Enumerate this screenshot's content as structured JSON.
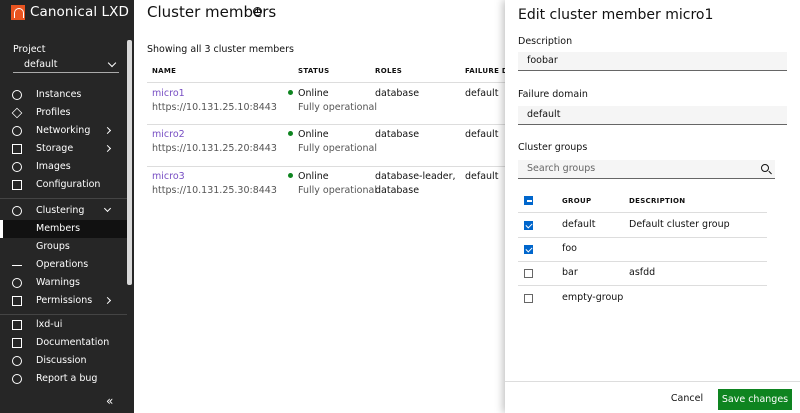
{
  "app": {
    "brand": "Canonical LXD"
  },
  "sidebar": {
    "project_label": "Project",
    "project_value": "default",
    "items": [
      {
        "label": "Instances",
        "icon": "instances-icon"
      },
      {
        "label": "Profiles",
        "icon": "profiles-icon"
      },
      {
        "label": "Networking",
        "icon": "networking-icon"
      },
      {
        "label": "Storage",
        "icon": "storage-icon"
      },
      {
        "label": "Images",
        "icon": "images-icon"
      },
      {
        "label": "Configuration",
        "icon": "configuration-icon"
      },
      {
        "label": "Clustering",
        "icon": "clustering-icon"
      },
      {
        "label": "Members"
      },
      {
        "label": "Groups"
      },
      {
        "label": "Operations",
        "icon": "operations-icon"
      },
      {
        "label": "Warnings",
        "icon": "warnings-icon"
      },
      {
        "label": "Permissions",
        "icon": "permissions-icon"
      },
      {
        "label": "lxd-ui",
        "icon": "lxd-ui-icon"
      },
      {
        "label": "Documentation",
        "icon": "documentation-icon"
      },
      {
        "label": "Discussion",
        "icon": "discussion-icon"
      },
      {
        "label": "Report a bug",
        "icon": "report-bug-icon"
      }
    ],
    "collapse_glyph": "«"
  },
  "main": {
    "title": "Cluster members",
    "showing": "Showing all 3 cluster members",
    "columns": [
      "NAME",
      "STATUS",
      "ROLES",
      "FAILURE DOMAIN"
    ],
    "rows": [
      {
        "name": "micro1",
        "url": "https://10.131.25.10:8443",
        "status": "Online",
        "status_detail": "Fully operational",
        "roles": [
          "database"
        ],
        "failure_domain": "default"
      },
      {
        "name": "micro2",
        "url": "https://10.131.25.20:8443",
        "status": "Online",
        "status_detail": "Fully operational",
        "roles": [
          "database"
        ],
        "failure_domain": "default"
      },
      {
        "name": "micro3",
        "url": "https://10.131.25.30:8443",
        "status": "Online",
        "status_detail": "Fully operational",
        "roles": [
          "database-leader,",
          "database"
        ],
        "failure_domain": "default"
      }
    ]
  },
  "panel": {
    "title": "Edit cluster member micro1",
    "description_label": "Description",
    "description_value": "foobar",
    "failure_domain_label": "Failure domain",
    "failure_domain_value": "default",
    "groups_label": "Cluster groups",
    "search_placeholder": "Search groups",
    "group_columns": [
      "GROUP",
      "DESCRIPTION"
    ],
    "groups": [
      {
        "name": "default",
        "description": "Default cluster group",
        "checked": true
      },
      {
        "name": "foo",
        "description": "",
        "checked": true
      },
      {
        "name": "bar",
        "description": "asfdd",
        "checked": false
      },
      {
        "name": "empty-group",
        "description": "",
        "checked": false
      }
    ],
    "cancel_label": "Cancel",
    "save_label": "Save changes"
  },
  "colors": {
    "sidebar_bg": "#262626",
    "link": "#774ec3",
    "online": "#0e8420",
    "save": "#0e8420",
    "checkbox": "#0066cc"
  }
}
